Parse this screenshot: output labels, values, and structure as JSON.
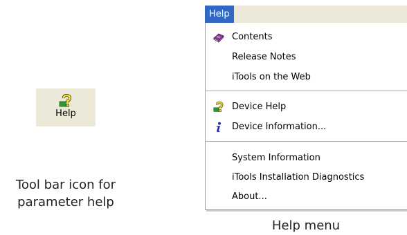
{
  "toolbar_button": {
    "label": "Help",
    "icon": "question-mark-help-icon"
  },
  "toolbar_caption": {
    "line1": "Tool bar icon for",
    "line2": "parameter help"
  },
  "menu": {
    "title": "Help",
    "items": [
      {
        "label": "Contents",
        "icon": "book-icon"
      },
      {
        "label": "Release Notes",
        "icon": ""
      },
      {
        "label": "iTools on the Web",
        "icon": ""
      },
      {
        "label": "Device Help",
        "icon": "question-mark-help-icon"
      },
      {
        "label": "Device Information...",
        "icon": "info-icon"
      },
      {
        "label": "System Information",
        "icon": ""
      },
      {
        "label": "iTools Installation Diagnostics",
        "icon": ""
      },
      {
        "label": "About...",
        "icon": ""
      }
    ]
  },
  "menu_caption": "Help menu",
  "colors": {
    "menu_highlight": "#316ac5",
    "menubar_background": "#ece9d8"
  }
}
